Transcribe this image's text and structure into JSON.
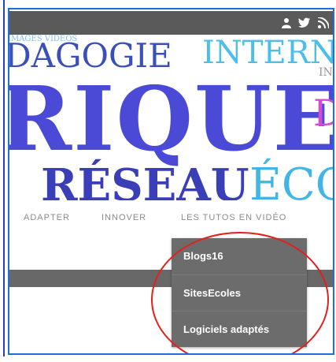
{
  "banner_words": {
    "pedagogie": "DAGOGIE",
    "internet": "INTERNE",
    "rique": "RIQUE",
    "reseau": "RÉSEAU",
    "ecole": "ÉCO",
    "images": "IMAGES VIDÉOS",
    "fragment_d": "D",
    "fragment_in": "IN"
  },
  "nav": {
    "items": [
      "ADAPTER",
      "INNOVER",
      "LES TUTOS EN VIDÉO"
    ]
  },
  "dropdown": {
    "items": [
      "Blogs16",
      "SitesEcoles",
      "Logiciels adaptés"
    ]
  },
  "icons": {
    "user": "user-icon",
    "twitter": "twitter-icon",
    "rss": "rss-icon"
  },
  "colors": {
    "topbar": "#5a5a5a",
    "dropdown": "#6c6c6c",
    "highlight_circle": "#e2201c",
    "frame_border": "#1e6fd9",
    "banner_blue": "#4a4ad6",
    "banner_cyan": "#3fb6e6",
    "banner_magenta": "#d64ad6"
  }
}
